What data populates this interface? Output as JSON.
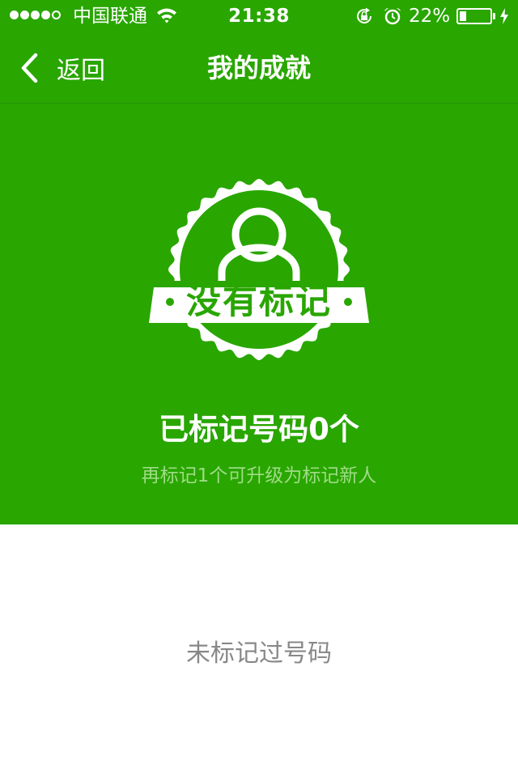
{
  "status_bar": {
    "signal_icon": "signal-dots-icon",
    "carrier": "中国联通",
    "wifi_icon": "wifi-icon",
    "time": "21:38",
    "rotation_lock_icon": "rotation-lock-icon",
    "alarm_icon": "alarm-icon",
    "battery_percent": "22%",
    "battery_level": 0.22,
    "charging_icon": "bolt-icon"
  },
  "nav": {
    "back_icon": "chevron-left-icon",
    "back_label": "返回",
    "title": "我的成就"
  },
  "achievement": {
    "badge_icon": "user-icon",
    "badge_label": "没有标记",
    "marked_count_text": "已标记号码0个",
    "upgrade_hint": "再标记1个可升级为标记新人"
  },
  "records": {
    "empty_text": "未标记过号码"
  },
  "colors": {
    "brand_green": "#29a600",
    "hint_green": "#9edc84",
    "empty_gray": "#888888"
  }
}
